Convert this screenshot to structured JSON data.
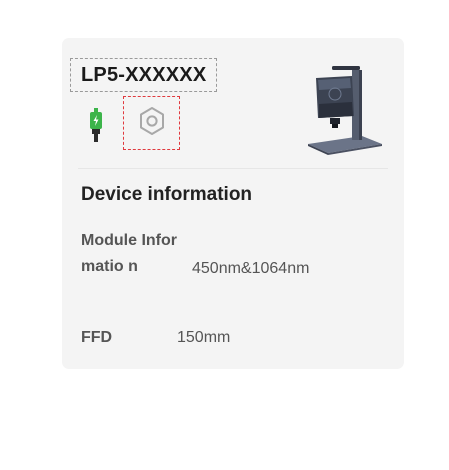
{
  "device": {
    "name": "LP5-XXXXXX",
    "connection_icon": "usb-connected-icon",
    "settings_icon": "gear-icon",
    "image": "laser-engraver-device-image"
  },
  "section": {
    "title": "Device information"
  },
  "info": {
    "module_label": "Module Informatio n",
    "module_value": "450nm&1064nm",
    "ffd_label": "FFD",
    "ffd_value": "150mm"
  },
  "colors": {
    "card_bg": "#f4f4f4",
    "usb_green": "#3cb44a",
    "settings_border": "#e0393e",
    "gear_gray": "#a8a8a8"
  }
}
